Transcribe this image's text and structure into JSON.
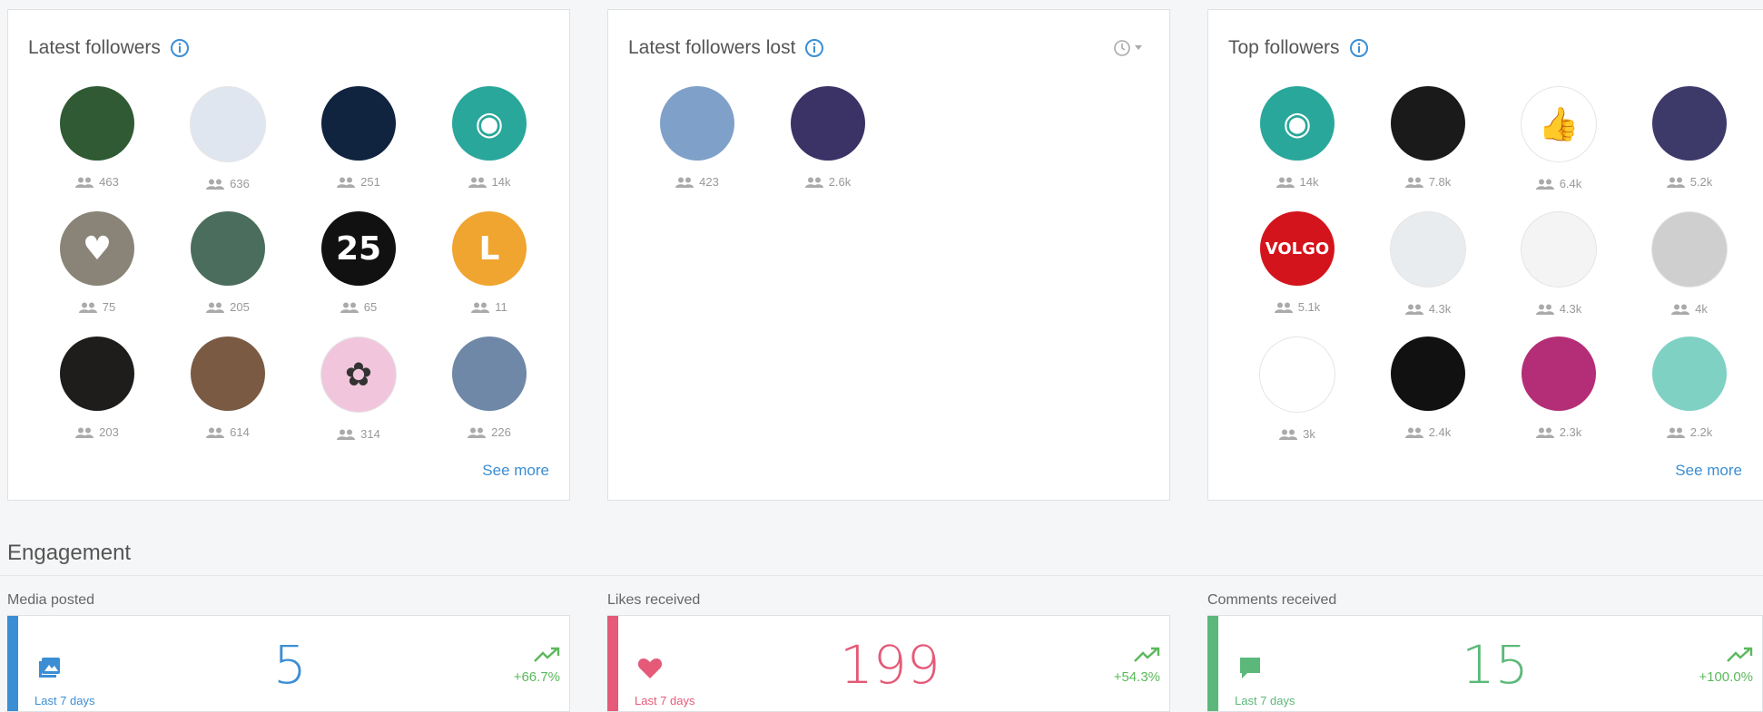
{
  "cards": {
    "latest": {
      "title": "Latest followers",
      "see_more": "See more",
      "items": [
        {
          "count": "463",
          "bg": "#2f5a33",
          "glyph": ""
        },
        {
          "count": "636",
          "bg": "#dfe6ef",
          "glyph": ""
        },
        {
          "count": "251",
          "bg": "#10233f",
          "glyph": ""
        },
        {
          "count": "14k",
          "bg": "#2aa79b",
          "glyph": "◉"
        },
        {
          "count": "75",
          "bg": "#8a8478",
          "glyph": "♥"
        },
        {
          "count": "205",
          "bg": "#4b6d5d",
          "glyph": ""
        },
        {
          "count": "65",
          "bg": "#111111",
          "glyph": "25"
        },
        {
          "count": "11",
          "bg": "#f0a531",
          "glyph": "L"
        },
        {
          "count": "203",
          "bg": "#1f1d1b",
          "glyph": ""
        },
        {
          "count": "614",
          "bg": "#7a5a43",
          "glyph": ""
        },
        {
          "count": "314",
          "bg": "#f1c6dd",
          "glyph": "✿"
        },
        {
          "count": "226",
          "bg": "#6f88a8",
          "glyph": ""
        }
      ]
    },
    "lost": {
      "title": "Latest followers lost",
      "items": [
        {
          "count": "423",
          "bg": "#7fa0c8",
          "glyph": ""
        },
        {
          "count": "2.6k",
          "bg": "#3b3366",
          "glyph": ""
        }
      ]
    },
    "top": {
      "title": "Top followers",
      "see_more": "See more",
      "items": [
        {
          "count": "14k",
          "bg": "#2aa79b",
          "glyph": "◉"
        },
        {
          "count": "7.8k",
          "bg": "#1a1a1a",
          "glyph": ""
        },
        {
          "count": "6.4k",
          "bg": "#ffffff",
          "glyph": "👍"
        },
        {
          "count": "5.2k",
          "bg": "#3d3a6a",
          "glyph": ""
        },
        {
          "count": "5.1k",
          "bg": "#d4141c",
          "glyph": "VOLGO"
        },
        {
          "count": "4.3k",
          "bg": "#e9ecef",
          "glyph": ""
        },
        {
          "count": "4.3k",
          "bg": "#f4f4f4",
          "glyph": ""
        },
        {
          "count": "4k",
          "bg": "#cfcfcf",
          "glyph": ""
        },
        {
          "count": "3k",
          "bg": "#ffffff",
          "glyph": ""
        },
        {
          "count": "2.4k",
          "bg": "#111111",
          "glyph": ""
        },
        {
          "count": "2.3k",
          "bg": "#b42e77",
          "glyph": ""
        },
        {
          "count": "2.2k",
          "bg": "#7fd1c4",
          "glyph": ""
        }
      ]
    }
  },
  "engagement": {
    "title": "Engagement",
    "metrics": [
      {
        "label": "Media posted",
        "value": "5",
        "period": "Last 7 days",
        "change": "+66.7%",
        "color": "#3b8ed4",
        "icon": "image-icon"
      },
      {
        "label": "Likes received",
        "value": "199",
        "period": "Last 7 days",
        "change": "+54.3%",
        "color": "#e45a78",
        "icon": "heart-icon"
      },
      {
        "label": "Comments received",
        "value": "15",
        "period": "Last 7 days",
        "change": "+100.0%",
        "color": "#5cb87a",
        "icon": "comment-icon"
      }
    ]
  }
}
